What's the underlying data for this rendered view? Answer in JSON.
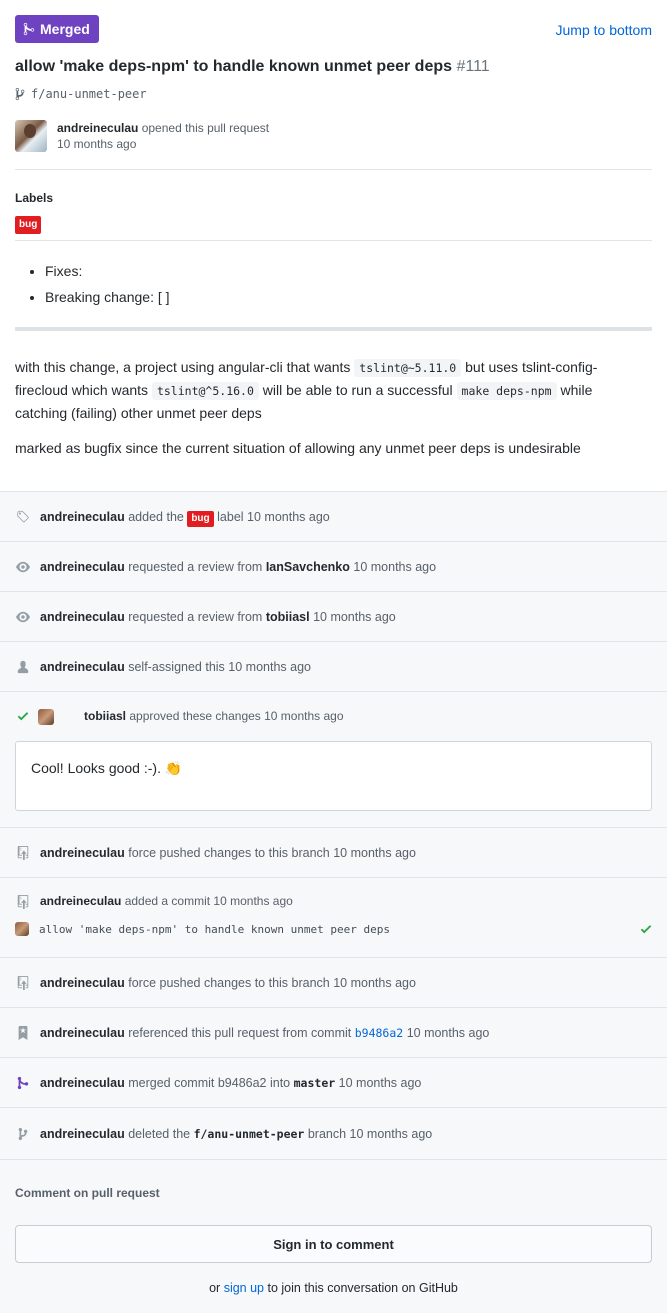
{
  "header": {
    "status_badge": "Merged",
    "jump_link": "Jump to bottom",
    "title": "allow 'make deps-npm' to handle known unmet peer deps",
    "number": "#111",
    "branch": "f/anu-unmet-peer",
    "author": "andreineculau",
    "opened_text": "opened this pull request",
    "opened_time": "10 months ago"
  },
  "labels": {
    "heading": "Labels",
    "items": [
      "bug"
    ],
    "bug_color": "#e11d21"
  },
  "body": {
    "bullets": [
      "Fixes:",
      "Breaking change: [ ]"
    ],
    "p1_a": "with this change, a project using angular-cli that wants ",
    "p1_code1": "tslint@~5.11.0",
    "p1_b": " but uses tslint-config-firecloud which wants ",
    "p1_code2": "tslint@^5.16.0",
    "p1_c": " will be able to run a successful ",
    "p1_code3": "make deps-npm",
    "p1_d": " while catching (failing) other unmet peer deps",
    "p2": "marked as bugfix since the current situation of allowing any unmet peer deps is undesirable"
  },
  "timeline": {
    "e1": {
      "actor": "andreineculau",
      "pre": "added the",
      "label": "bug",
      "post": "label 10 months ago",
      "icon": "tag-icon"
    },
    "e2": {
      "actor": "andreineculau",
      "text": "requested a review from",
      "target": "IanSavchenko",
      "time": "10 months ago",
      "icon": "eye-icon"
    },
    "e3": {
      "actor": "andreineculau",
      "text": "requested a review from",
      "target": "tobiiasl",
      "time": "10 months ago",
      "icon": "eye-icon"
    },
    "e4": {
      "actor": "andreineculau",
      "text": "self-assigned this 10 months ago",
      "icon": "person-icon"
    },
    "e5": {
      "actor": "tobiiasl",
      "text": "approved these changes 10 months ago",
      "comment": "Cool! Looks good :-). 👏",
      "icon": "check-icon"
    },
    "e6": {
      "actor": "andreineculau",
      "text": "force pushed changes to this branch 10 months ago",
      "icon": "repo-push-icon"
    },
    "e7": {
      "actor": "andreineculau",
      "text": "added a commit 10 months ago",
      "commit_msg": "allow 'make deps-npm' to handle known unmet peer deps",
      "icon": "repo-push-icon"
    },
    "e8": {
      "actor": "andreineculau",
      "text": "force pushed changes to this branch 10 months ago",
      "icon": "repo-push-icon"
    },
    "e9": {
      "actor": "andreineculau",
      "pre": "referenced this pull request from commit",
      "sha": "b9486a2",
      "time": "10 months ago",
      "icon": "bookmark-icon"
    },
    "e10": {
      "actor": "andreineculau",
      "pre": "merged commit b9486a2 into",
      "target": "master",
      "time": "10 months ago",
      "icon": "merge-icon"
    },
    "e11": {
      "actor": "andreineculau",
      "pre": "deleted the",
      "target": "f/anu-unmet-peer",
      "post": "branch 10 months ago",
      "icon": "branch-icon"
    }
  },
  "footer": {
    "comment_heading": "Comment on pull request",
    "signin_button": "Sign in to comment",
    "join_pre": "or",
    "join_link": "sign up",
    "join_post": "to join this conversation on GitHub"
  },
  "colors": {
    "merged": "#6f42c1",
    "link": "#0366d6",
    "success": "#28a745"
  }
}
